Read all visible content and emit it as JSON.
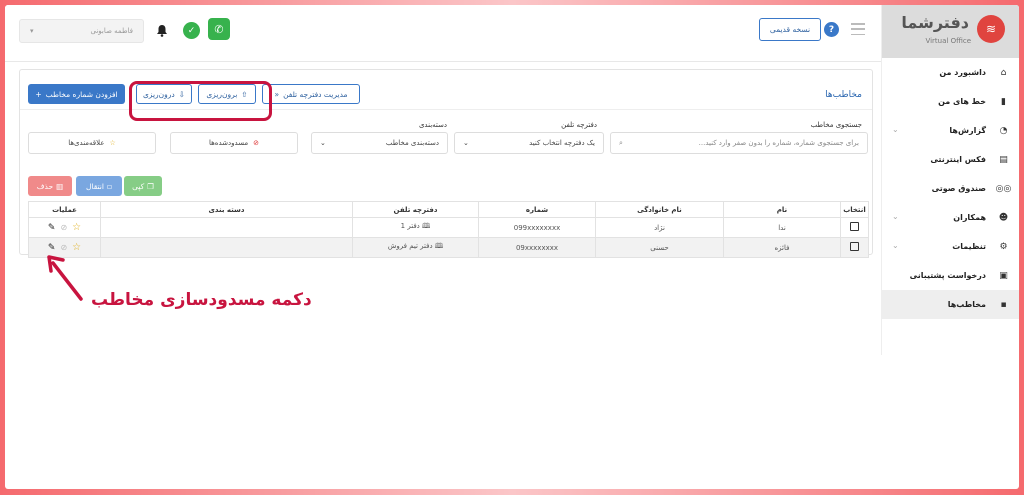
{
  "header": {
    "user_name": "فاطمه صابونی",
    "old_version": "نسخه قدیمی",
    "help": "?"
  },
  "sidebar": {
    "logo": "دفترشما",
    "logo_sub": "Virtual Office",
    "items": [
      {
        "label": "داشبورد من",
        "icon": "home-icon"
      },
      {
        "label": "خط های من",
        "icon": "sim-card-icon"
      },
      {
        "label": "گزارش‌ها",
        "icon": "pie-chart-icon",
        "expandable": true
      },
      {
        "label": "فکس اینترنتی",
        "icon": "fax-icon"
      },
      {
        "label": "صندوق صوتی",
        "icon": "voicemail-icon"
      },
      {
        "label": "همکاران",
        "icon": "users-icon",
        "expandable": true
      },
      {
        "label": "تنظیمات",
        "icon": "gear-icon",
        "expandable": true
      },
      {
        "label": "درخواست پشتیبانی",
        "icon": "ticket-icon"
      },
      {
        "label": "مخاطب‌ها",
        "icon": "contact-icon",
        "active": true
      }
    ]
  },
  "main": {
    "title": "مخاطب‌ها",
    "buttons": {
      "add": "افزودن شماره مخاطب",
      "export": "برون‌ریزی",
      "import": "درون‌ریزی",
      "manage": "مدیریت دفترچه تلفن"
    },
    "filters": {
      "search_label": "جستجوی مخاطب",
      "search_placeholder": "برای جستجوی شماره، شماره را بدون صفر وارد کنید...",
      "phonebook_label": "دفترچه تلفن",
      "phonebook_value": "یک دفترچه انتخاب کنید",
      "category_label": "دسته‌بندی",
      "category_value": "دسته‌بندی مخاطب",
      "blocked": "مسدودشده‌ها",
      "favorites": "علاقه‌مندی‌ها"
    },
    "actions": {
      "delete": "حذف",
      "move": "انتقال",
      "copy": "کپی"
    },
    "table": {
      "columns": [
        "انتخاب",
        "نام",
        "نام خانوادگی",
        "شماره",
        "دفترچه تلفن",
        "دسته بندی",
        "عملیات"
      ],
      "rows": [
        {
          "first": "ندا",
          "last": "نژاد",
          "number": "099xxxxxxxx",
          "book": "دفتر 1",
          "category": ""
        },
        {
          "first": "فائزه",
          "last": "حسنی",
          "number": "09xxxxxxxx",
          "book": "دفتر تیم فروش",
          "category": ""
        }
      ]
    }
  },
  "annotation": {
    "text": "دکمه مسدودسازی مخاطب",
    "color": "#c8143f"
  }
}
